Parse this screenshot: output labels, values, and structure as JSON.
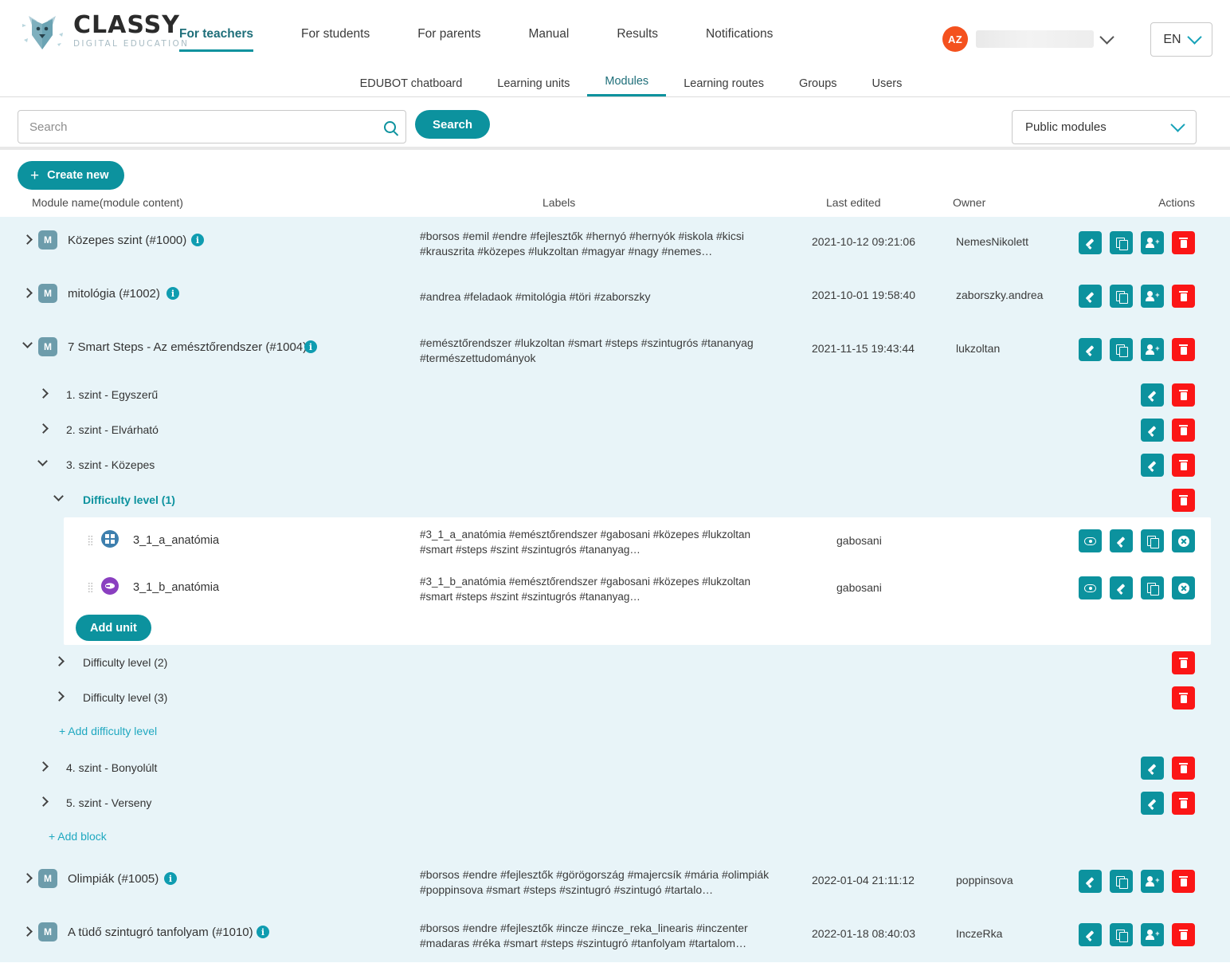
{
  "brand": {
    "title": "CLASSY",
    "subtitle": "DIGITAL EDUCATION"
  },
  "mainnav": [
    {
      "label": "For teachers",
      "active": true
    },
    {
      "label": "For students",
      "active": false
    },
    {
      "label": "For parents",
      "active": false
    },
    {
      "label": "Manual",
      "active": false
    },
    {
      "label": "Results",
      "active": false
    },
    {
      "label": "Notifications",
      "active": false
    }
  ],
  "user": {
    "initials": "AZ",
    "language": "EN"
  },
  "subnav": [
    {
      "label": "EDUBOT chatboard",
      "active": false
    },
    {
      "label": "Learning units",
      "active": false
    },
    {
      "label": "Modules",
      "active": true
    },
    {
      "label": "Learning routes",
      "active": false
    },
    {
      "label": "Groups",
      "active": false
    },
    {
      "label": "Users",
      "active": false
    }
  ],
  "search": {
    "placeholder": "Search",
    "value": "",
    "button": "Search"
  },
  "filter": {
    "selected": "Public modules"
  },
  "toolbar": {
    "create_label": "Create new",
    "plus": "+"
  },
  "table": {
    "headers": {
      "name": "Module name(module content)",
      "labels": "Labels",
      "edited": "Last edited",
      "owner": "Owner",
      "actions": "Actions"
    }
  },
  "modules": [
    {
      "badge": "M",
      "name": "Közepes szint (#1000)",
      "labels": "#borsos #emil #endre #fejlesztők #hernyó #hernyók #iskola #kicsi #krauszrita #közepes #lukzoltan #magyar #nagy #nemes…",
      "edited": "2021-10-12 09:21:06",
      "owner": "NemesNikolett"
    },
    {
      "badge": "M",
      "name": "mitológia (#1002)",
      "labels": "#andrea #feladaok #mitológia #töri #zaborszky",
      "edited": "2021-10-01 19:58:40",
      "owner": "zaborszky.andrea"
    },
    {
      "badge": "M",
      "name": "7 Smart Steps - Az emésztőrendszer (#1004)",
      "labels": "#emésztőrendszer #lukzoltan #smart #steps #szintugrós #tananyag #természettudományok",
      "edited": "2021-11-15 19:43:44",
      "owner": "lukzoltan"
    },
    {
      "badge": "M",
      "name": "Olimpiák (#1005)",
      "labels": "#borsos #endre #fejlesztők #görögország #majercsík #mária #olimpiák #poppinsova #smart #steps #szintugró #szintugó #tartalo…",
      "edited": "2022-01-04 21:11:12",
      "owner": "poppinsova"
    },
    {
      "badge": "M",
      "name": "A tüdő szintugró tanfolyam (#1010)",
      "labels": "#borsos #endre #fejlesztők #incze #incze_reka_linearis #inczenter #madaras #réka #smart #steps #szintugró #tanfolyam #tartalom…",
      "edited": "2022-01-18 08:40:03",
      "owner": "InczeRka"
    }
  ],
  "blocks": [
    {
      "label": "1. szint - Egyszerű"
    },
    {
      "label": "2. szint - Elvárható"
    },
    {
      "label": "3. szint - Közepes"
    },
    {
      "label": "4. szint - Bonyolúlt"
    },
    {
      "label": "5. szint - Verseny"
    }
  ],
  "difficulty_levels": [
    {
      "label": "Difficulty level (1)",
      "expanded": true
    },
    {
      "label": "Difficulty level (2)",
      "expanded": false
    },
    {
      "label": "Difficulty level (3)",
      "expanded": false
    }
  ],
  "units": [
    {
      "name": "3_1_a_anatómia",
      "labels": "#3_1_a_anatómia #emésztőrendszer #gabosani #közepes #lukzoltan #smart #steps #szint #szintugrós #tananyag…",
      "owner": "gabosani",
      "icon_color": "#3d7fae"
    },
    {
      "name": "3_1_b_anatómia",
      "labels": "#3_1_b_anatómia #emésztőrendszer #gabosani #közepes #lukzoltan #smart #steps #szint #szintugrós #tananyag…",
      "owner": "gabosani",
      "icon_color": "#8a3fc0"
    }
  ],
  "links": {
    "add_unit": "Add unit",
    "add_difficulty_level": "+ Add difficulty level",
    "add_block": "+ Add block"
  },
  "colors": {
    "accent": "#0c929e",
    "danger": "#fb1616",
    "avatar": "#f4511e",
    "row_bg": "#e8f4f8",
    "link": "#1fa8c0"
  }
}
